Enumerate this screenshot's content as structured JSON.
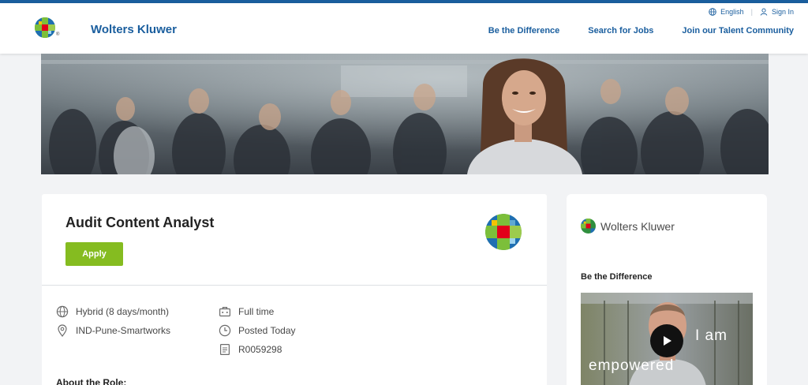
{
  "header": {
    "brand": "Wolters Kluwer",
    "reg_mark": "®",
    "language": "English",
    "sign_in": "Sign In",
    "nav": [
      "Be the Difference",
      "Search for Jobs",
      "Join our Talent Community"
    ]
  },
  "job": {
    "title": "Audit Content Analyst",
    "apply_label": "Apply",
    "work_mode": "Hybrid (8 days/month)",
    "location": "IND-Pune-Smartworks",
    "employment_type": "Full time",
    "posted": "Posted Today",
    "requisition": "R0059298",
    "about_heading": "About the Role:"
  },
  "sidebar": {
    "brand": "Wolters Kluwer",
    "section_title": "Be the Difference",
    "video_caption_1": "I am",
    "video_caption_2": "empowered"
  },
  "colors": {
    "brand_blue": "#1a5e9e",
    "apply_green": "#85bc20",
    "page_bg": "#f2f3f5"
  },
  "icons": [
    "globe-icon",
    "user-icon",
    "location-pin-icon",
    "briefcase-icon",
    "clock-icon",
    "document-icon",
    "play-icon"
  ]
}
